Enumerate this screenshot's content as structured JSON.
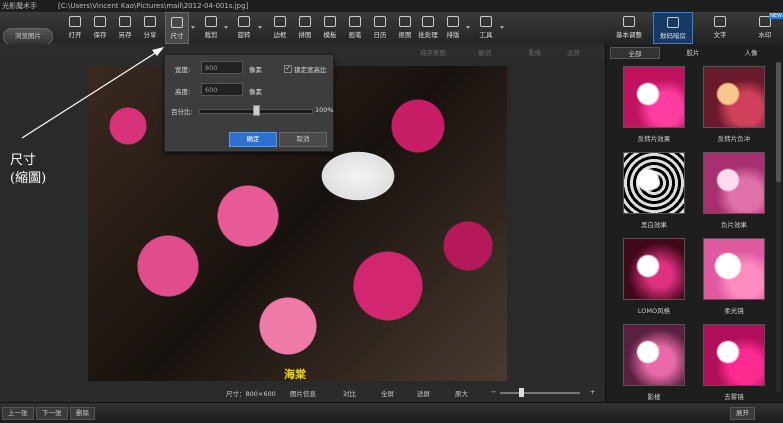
{
  "window": {
    "app_title": "光影魔术手",
    "path": "[C:\\Users\\Vincent Kao\\Pictures\\mail\\2012-04-001s.jpg]"
  },
  "toolbar": {
    "browse_label": "浏览图片",
    "buttons": [
      "打开",
      "保存",
      "另存",
      "分享",
      "尺寸",
      "裁剪",
      "旋转",
      "边框",
      "拼图",
      "模板",
      "画笔",
      "日历",
      "抠图",
      "批处理",
      "排版",
      "工具"
    ]
  },
  "right_tabs": {
    "items": [
      "基本调整",
      "数码暗房",
      "文字",
      "水印"
    ],
    "new_tag": "NEW"
  },
  "undo_bar": {
    "save_original": "保存原图",
    "undo": "撤销",
    "redo": "重做",
    "restore": "还原"
  },
  "resize_popup": {
    "width_label": "宽度:",
    "width_value": "800",
    "width_unit": "像素",
    "height_label": "高度:",
    "height_value": "600",
    "height_unit": "像素",
    "lock_label": "锁定宽高比",
    "percent_label": "百分比:",
    "percent_value": "100%",
    "slider_level": 0.5,
    "ok": "确定",
    "cancel": "取消"
  },
  "annotation": {
    "line1": "尺寸",
    "line2": "(縮圖)"
  },
  "photo": {
    "caption": "海棠"
  },
  "view_bar": {
    "size_label": "尺寸：800×600",
    "items": [
      "图片信息",
      "对比",
      "全屏",
      "适屏",
      "原大"
    ],
    "minus": "−",
    "plus": "+"
  },
  "bottom_bar": {
    "prev": "上一张",
    "next": "下一张",
    "delete": "删除",
    "expand": "展开"
  },
  "right_panel": {
    "subtabs": [
      "全部",
      "胶片",
      "人像"
    ],
    "effects": [
      "反转片效果",
      "反转片负冲",
      "黑白效果",
      "负片效果",
      "LOMO风格",
      "柔光镜",
      "影楼",
      "去雾镜"
    ]
  },
  "colors": {
    "accent": "#2e6fd0",
    "panel": "#1e1e1e",
    "caption": "#f0d020"
  }
}
